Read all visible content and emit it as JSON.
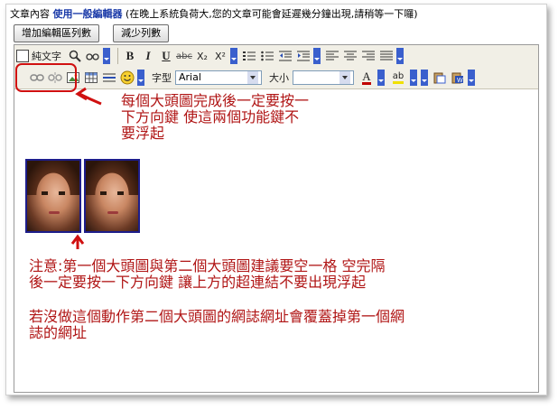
{
  "header": {
    "label": "文章內容",
    "editor_name": "使用一般編輯器",
    "note": "(在晚上系統負荷大,您的文章可能會延遲幾分鐘出現,請稍等一下囉)"
  },
  "buttons": {
    "increase_rows": "增加編輯區列數",
    "decrease_rows": "減少列數"
  },
  "toolbar": {
    "plain_text_label": "純文字",
    "font_label": "字型",
    "font_value": "Arial",
    "size_label": "大小",
    "size_value": "",
    "bold": "B",
    "italic": "I",
    "underline": "U",
    "strikethrough": "abc",
    "subscript": "X₂",
    "superscript": "X²",
    "font_color_glyph": "A",
    "highlight_glyph": "ab",
    "emoji_glyph": "☺"
  },
  "annotations": {
    "note1": [
      "每個大頭圖完成後一定要按一",
      "下方向鍵   使這兩個功能鍵不",
      "要浮起"
    ],
    "note2": [
      "注意:第一個大頭圖與第二個大頭圖建議要空一格     空完隔",
      "後一定要按一下方向鍵      讓上方的超連結不要出現浮起"
    ],
    "note3": [
      "若沒做這個動作第二個大頭圖的網誌網址會覆蓋掉第一個網",
      "誌的網址"
    ]
  },
  "colors": {
    "annotation": "#b01515",
    "editor_name": "#1a3aa8",
    "toolbar_bg": "#f1efe6",
    "dropdown_accent": "#3a5fcd",
    "photo_border": "#1d1d8a"
  },
  "icons": [
    "link-icon",
    "unlink-icon",
    "image-icon",
    "table-icon",
    "horizontal-rule-icon",
    "emoji-icon",
    "font-color-icon",
    "highlight-icon",
    "paste-icon",
    "paste-word-icon",
    "find-icon",
    "replace-icon",
    "ordered-list-icon",
    "unordered-list-icon",
    "outdent-icon",
    "indent-icon",
    "align-left-icon",
    "align-center-icon",
    "align-right-icon",
    "justify-icon"
  ]
}
